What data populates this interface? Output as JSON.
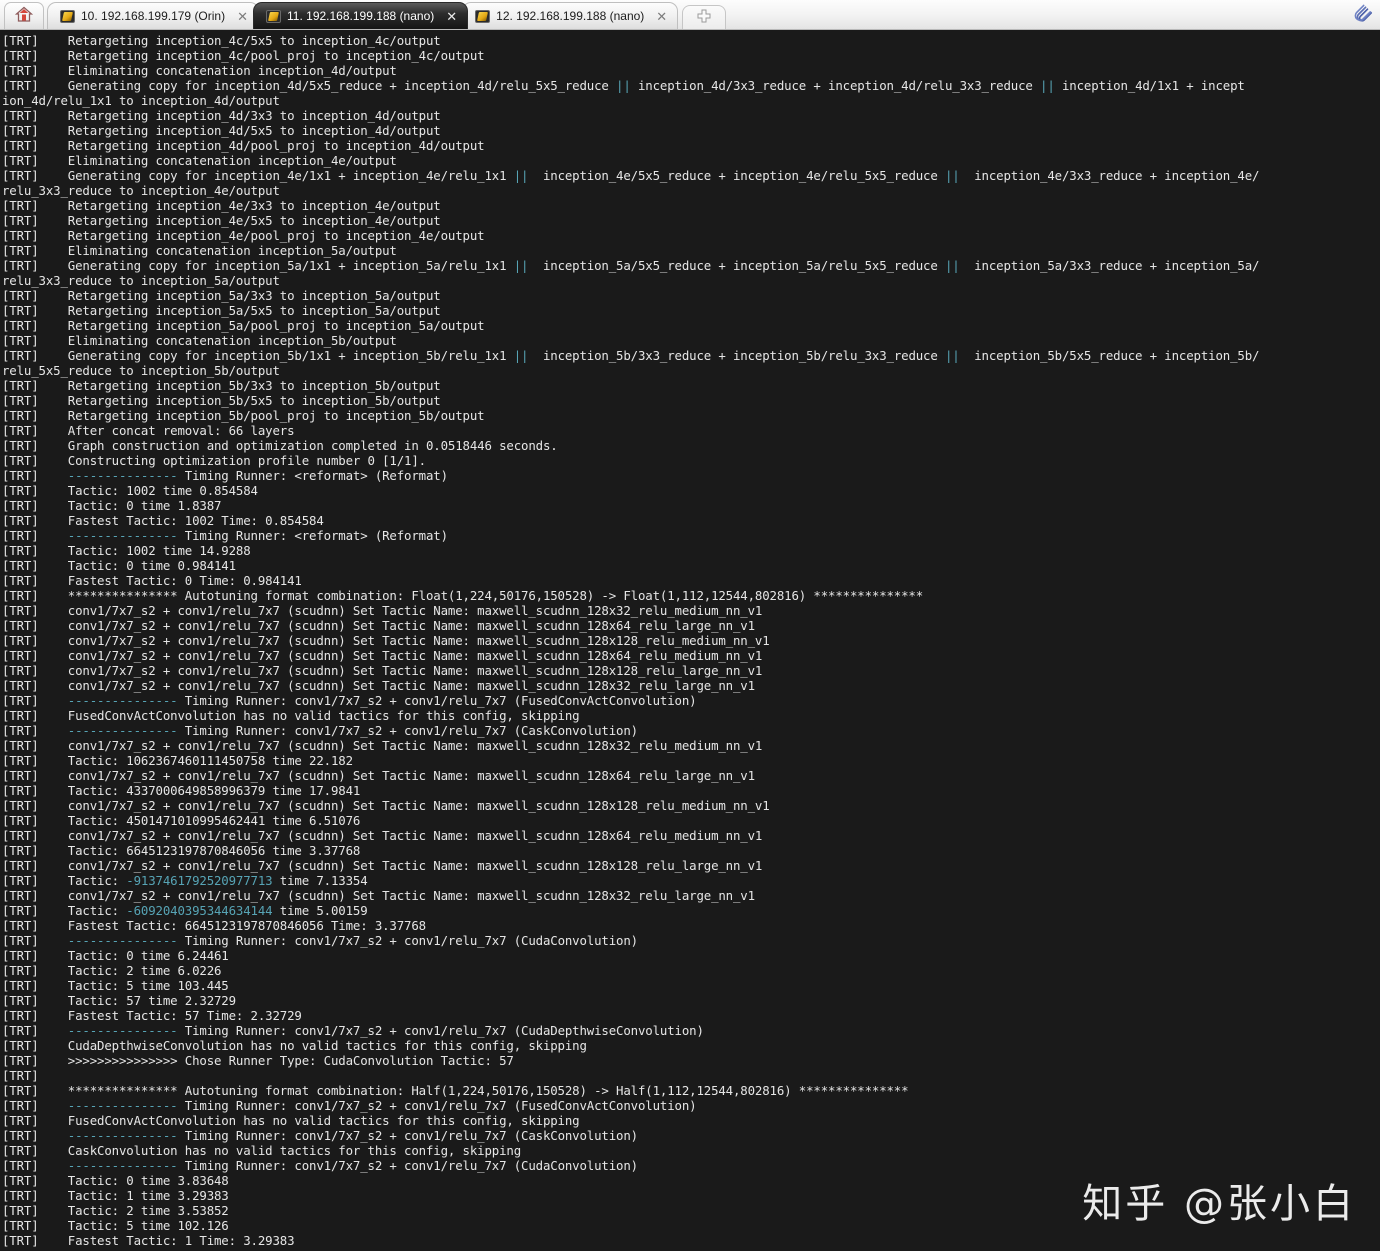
{
  "window": {
    "home_tab_icon": "home-icon",
    "attach_icon": "paperclip-icon",
    "new_tab_label": "+",
    "close_glyph": "✕"
  },
  "tabs": [
    {
      "label": "10. 192.168.199.179 (Orin)",
      "icon": "putty-terminal-icon",
      "active": false
    },
    {
      "label": "11. 192.168.199.188 (nano)",
      "icon": "putty-terminal-icon",
      "active": true
    },
    {
      "label": "12. 192.168.199.188 (nano)",
      "icon": "putty-terminal-icon",
      "active": false
    }
  ],
  "terminal": {
    "prefix": "[TRT]",
    "colors": {
      "background": "#1a1a1a",
      "foreground": "#e6e6e6",
      "accent": "#57a4b5"
    },
    "lines": [
      {
        "tag": "[TRT]",
        "segs": [
          {
            "t": "    Retargeting inception_4c/5x5 to inception_4c/output"
          }
        ]
      },
      {
        "tag": "[TRT]",
        "segs": [
          {
            "t": "    Retargeting inception_4c/pool_proj to inception_4c/output"
          }
        ]
      },
      {
        "tag": "[TRT]",
        "segs": [
          {
            "t": "    Eliminating concatenation inception_4d/output"
          }
        ]
      },
      {
        "tag": "[TRT]",
        "segs": [
          {
            "t": "    Generating copy for inception_4d/5x5_reduce + inception_4d/relu_5x5_reduce "
          },
          {
            "t": "||",
            "c": "cyan"
          },
          {
            "t": " inception_4d/3x3_reduce + inception_4d/relu_3x3_reduce "
          },
          {
            "t": "||",
            "c": "cyan"
          },
          {
            "t": " inception_4d/1x1 + incept"
          }
        ]
      },
      {
        "tag": "",
        "segs": [
          {
            "t": "ion_4d/relu_1x1 to inception_4d/output"
          }
        ]
      },
      {
        "tag": "[TRT]",
        "segs": [
          {
            "t": "    Retargeting inception_4d/3x3 to inception_4d/output"
          }
        ]
      },
      {
        "tag": "[TRT]",
        "segs": [
          {
            "t": "    Retargeting inception_4d/5x5 to inception_4d/output"
          }
        ]
      },
      {
        "tag": "[TRT]",
        "segs": [
          {
            "t": "    Retargeting inception_4d/pool_proj to inception_4d/output"
          }
        ]
      },
      {
        "tag": "[TRT]",
        "segs": [
          {
            "t": "    Eliminating concatenation inception_4e/output"
          }
        ]
      },
      {
        "tag": "[TRT]",
        "segs": [
          {
            "t": "    Generating copy for inception_4e/1x1 + inception_4e/relu_1x1 "
          },
          {
            "t": "||",
            "c": "cyan"
          },
          {
            "t": "  inception_4e/5x5_reduce + inception_4e/relu_5x5_reduce "
          },
          {
            "t": "||",
            "c": "cyan"
          },
          {
            "t": "  inception_4e/3x3_reduce + inception_4e/"
          }
        ]
      },
      {
        "tag": "",
        "segs": [
          {
            "t": "relu_3x3_reduce to inception_4e/output"
          }
        ]
      },
      {
        "tag": "[TRT]",
        "segs": [
          {
            "t": "    Retargeting inception_4e/3x3 to inception_4e/output"
          }
        ]
      },
      {
        "tag": "[TRT]",
        "segs": [
          {
            "t": "    Retargeting inception_4e/5x5 to inception_4e/output"
          }
        ]
      },
      {
        "tag": "[TRT]",
        "segs": [
          {
            "t": "    Retargeting inception_4e/pool_proj to inception_4e/output"
          }
        ]
      },
      {
        "tag": "[TRT]",
        "segs": [
          {
            "t": "    Eliminating concatenation inception_5a/output"
          }
        ]
      },
      {
        "tag": "[TRT]",
        "segs": [
          {
            "t": "    Generating copy for inception_5a/1x1 + inception_5a/relu_1x1 "
          },
          {
            "t": "||",
            "c": "cyan"
          },
          {
            "t": "  inception_5a/5x5_reduce + inception_5a/relu_5x5_reduce "
          },
          {
            "t": "||",
            "c": "cyan"
          },
          {
            "t": "  inception_5a/3x3_reduce + inception_5a/"
          }
        ]
      },
      {
        "tag": "",
        "segs": [
          {
            "t": "relu_3x3_reduce to inception_5a/output"
          }
        ]
      },
      {
        "tag": "[TRT]",
        "segs": [
          {
            "t": "    Retargeting inception_5a/3x3 to inception_5a/output"
          }
        ]
      },
      {
        "tag": "[TRT]",
        "segs": [
          {
            "t": "    Retargeting inception_5a/5x5 to inception_5a/output"
          }
        ]
      },
      {
        "tag": "[TRT]",
        "segs": [
          {
            "t": "    Retargeting inception_5a/pool_proj to inception_5a/output"
          }
        ]
      },
      {
        "tag": "[TRT]",
        "segs": [
          {
            "t": "    Eliminating concatenation inception_5b/output"
          }
        ]
      },
      {
        "tag": "[TRT]",
        "segs": [
          {
            "t": "    Generating copy for inception_5b/1x1 + inception_5b/relu_1x1 "
          },
          {
            "t": "||",
            "c": "cyan"
          },
          {
            "t": "  inception_5b/3x3_reduce + inception_5b/relu_3x3_reduce "
          },
          {
            "t": "||",
            "c": "cyan"
          },
          {
            "t": "  inception_5b/5x5_reduce + inception_5b/"
          }
        ]
      },
      {
        "tag": "",
        "segs": [
          {
            "t": "relu_5x5_reduce to inception_5b/output"
          }
        ]
      },
      {
        "tag": "[TRT]",
        "segs": [
          {
            "t": "    Retargeting inception_5b/3x3 to inception_5b/output"
          }
        ]
      },
      {
        "tag": "[TRT]",
        "segs": [
          {
            "t": "    Retargeting inception_5b/5x5 to inception_5b/output"
          }
        ]
      },
      {
        "tag": "[TRT]",
        "segs": [
          {
            "t": "    Retargeting inception_5b/pool_proj to inception_5b/output"
          }
        ]
      },
      {
        "tag": "[TRT]",
        "segs": [
          {
            "t": "    After concat removal: 66 layers"
          }
        ]
      },
      {
        "tag": "[TRT]",
        "segs": [
          {
            "t": "    Graph construction and optimization completed in 0.0518446 seconds."
          }
        ]
      },
      {
        "tag": "[TRT]",
        "segs": [
          {
            "t": "    Constructing optimization profile number 0 [1/1]."
          }
        ]
      },
      {
        "tag": "[TRT]",
        "segs": [
          {
            "t": "    ---------------",
            "c": "cyan"
          },
          {
            "t": " Timing Runner: <reformat> (Reformat)"
          }
        ]
      },
      {
        "tag": "[TRT]",
        "segs": [
          {
            "t": "    Tactic: 1002 time 0.854584"
          }
        ]
      },
      {
        "tag": "[TRT]",
        "segs": [
          {
            "t": "    Tactic: 0 time 1.8387"
          }
        ]
      },
      {
        "tag": "[TRT]",
        "segs": [
          {
            "t": "    Fastest Tactic: 1002 Time: 0.854584"
          }
        ]
      },
      {
        "tag": "[TRT]",
        "segs": [
          {
            "t": "    ---------------",
            "c": "cyan"
          },
          {
            "t": " Timing Runner: <reformat> (Reformat)"
          }
        ]
      },
      {
        "tag": "[TRT]",
        "segs": [
          {
            "t": "    Tactic: 1002 time 14.9288"
          }
        ]
      },
      {
        "tag": "[TRT]",
        "segs": [
          {
            "t": "    Tactic: 0 time 0.984141"
          }
        ]
      },
      {
        "tag": "[TRT]",
        "segs": [
          {
            "t": "    Fastest Tactic: 0 Time: 0.984141"
          }
        ]
      },
      {
        "tag": "[TRT]",
        "segs": [
          {
            "t": "    *************** Autotuning format combination: Float(1,224,50176,150528) -> Float(1,112,12544,802816) ***************"
          }
        ]
      },
      {
        "tag": "[TRT]",
        "segs": [
          {
            "t": "    conv1/7x7_s2 + conv1/relu_7x7 (scudnn) Set Tactic Name: maxwell_scudnn_128x32_relu_medium_nn_v1"
          }
        ]
      },
      {
        "tag": "[TRT]",
        "segs": [
          {
            "t": "    conv1/7x7_s2 + conv1/relu_7x7 (scudnn) Set Tactic Name: maxwell_scudnn_128x64_relu_large_nn_v1"
          }
        ]
      },
      {
        "tag": "[TRT]",
        "segs": [
          {
            "t": "    conv1/7x7_s2 + conv1/relu_7x7 (scudnn) Set Tactic Name: maxwell_scudnn_128x128_relu_medium_nn_v1"
          }
        ]
      },
      {
        "tag": "[TRT]",
        "segs": [
          {
            "t": "    conv1/7x7_s2 + conv1/relu_7x7 (scudnn) Set Tactic Name: maxwell_scudnn_128x64_relu_medium_nn_v1"
          }
        ]
      },
      {
        "tag": "[TRT]",
        "segs": [
          {
            "t": "    conv1/7x7_s2 + conv1/relu_7x7 (scudnn) Set Tactic Name: maxwell_scudnn_128x128_relu_large_nn_v1"
          }
        ]
      },
      {
        "tag": "[TRT]",
        "segs": [
          {
            "t": "    conv1/7x7_s2 + conv1/relu_7x7 (scudnn) Set Tactic Name: maxwell_scudnn_128x32_relu_large_nn_v1"
          }
        ]
      },
      {
        "tag": "[TRT]",
        "segs": [
          {
            "t": "    ---------------",
            "c": "cyan"
          },
          {
            "t": " Timing Runner: conv1/7x7_s2 + conv1/relu_7x7 (FusedConvActConvolution)"
          }
        ]
      },
      {
        "tag": "[TRT]",
        "segs": [
          {
            "t": "    FusedConvActConvolution has no valid tactics for this config, skipping"
          }
        ]
      },
      {
        "tag": "[TRT]",
        "segs": [
          {
            "t": "    ---------------",
            "c": "cyan"
          },
          {
            "t": " Timing Runner: conv1/7x7_s2 + conv1/relu_7x7 (CaskConvolution)"
          }
        ]
      },
      {
        "tag": "[TRT]",
        "segs": [
          {
            "t": "    conv1/7x7_s2 + conv1/relu_7x7 (scudnn) Set Tactic Name: maxwell_scudnn_128x32_relu_medium_nn_v1"
          }
        ]
      },
      {
        "tag": "[TRT]",
        "segs": [
          {
            "t": "    Tactic: 1062367460111450758 time 22.182"
          }
        ]
      },
      {
        "tag": "[TRT]",
        "segs": [
          {
            "t": "    conv1/7x7_s2 + conv1/relu_7x7 (scudnn) Set Tactic Name: maxwell_scudnn_128x64_relu_large_nn_v1"
          }
        ]
      },
      {
        "tag": "[TRT]",
        "segs": [
          {
            "t": "    Tactic: 4337000649858996379 time 17.9841"
          }
        ]
      },
      {
        "tag": "[TRT]",
        "segs": [
          {
            "t": "    conv1/7x7_s2 + conv1/relu_7x7 (scudnn) Set Tactic Name: maxwell_scudnn_128x128_relu_medium_nn_v1"
          }
        ]
      },
      {
        "tag": "[TRT]",
        "segs": [
          {
            "t": "    Tactic: 4501471010995462441 time 6.51076"
          }
        ]
      },
      {
        "tag": "[TRT]",
        "segs": [
          {
            "t": "    conv1/7x7_s2 + conv1/relu_7x7 (scudnn) Set Tactic Name: maxwell_scudnn_128x64_relu_medium_nn_v1"
          }
        ]
      },
      {
        "tag": "[TRT]",
        "segs": [
          {
            "t": "    Tactic: 6645123197870846056 time 3.37768"
          }
        ]
      },
      {
        "tag": "[TRT]",
        "segs": [
          {
            "t": "    conv1/7x7_s2 + conv1/relu_7x7 (scudnn) Set Tactic Name: maxwell_scudnn_128x128_relu_large_nn_v1"
          }
        ]
      },
      {
        "tag": "[TRT]",
        "segs": [
          {
            "t": "    Tactic: "
          },
          {
            "t": "-9137461792520977713",
            "c": "cyan"
          },
          {
            "t": " time 7.13354"
          }
        ]
      },
      {
        "tag": "[TRT]",
        "segs": [
          {
            "t": "    conv1/7x7_s2 + conv1/relu_7x7 (scudnn) Set Tactic Name: maxwell_scudnn_128x32_relu_large_nn_v1"
          }
        ]
      },
      {
        "tag": "[TRT]",
        "segs": [
          {
            "t": "    Tactic: "
          },
          {
            "t": "-6092040395344634144",
            "c": "cyan"
          },
          {
            "t": " time 5.00159"
          }
        ]
      },
      {
        "tag": "[TRT]",
        "segs": [
          {
            "t": "    Fastest Tactic: 6645123197870846056 Time: 3.37768"
          }
        ]
      },
      {
        "tag": "[TRT]",
        "segs": [
          {
            "t": "    ---------------",
            "c": "cyan"
          },
          {
            "t": " Timing Runner: conv1/7x7_s2 + conv1/relu_7x7 (CudaConvolution)"
          }
        ]
      },
      {
        "tag": "[TRT]",
        "segs": [
          {
            "t": "    Tactic: 0 time 6.24461"
          }
        ]
      },
      {
        "tag": "[TRT]",
        "segs": [
          {
            "t": "    Tactic: 2 time 6.0226"
          }
        ]
      },
      {
        "tag": "[TRT]",
        "segs": [
          {
            "t": "    Tactic: 5 time 103.445"
          }
        ]
      },
      {
        "tag": "[TRT]",
        "segs": [
          {
            "t": "    Tactic: 57 time 2.32729"
          }
        ]
      },
      {
        "tag": "[TRT]",
        "segs": [
          {
            "t": "    Fastest Tactic: 57 Time: 2.32729"
          }
        ]
      },
      {
        "tag": "[TRT]",
        "segs": [
          {
            "t": "    ---------------",
            "c": "cyan"
          },
          {
            "t": " Timing Runner: conv1/7x7_s2 + conv1/relu_7x7 (CudaDepthwiseConvolution)"
          }
        ]
      },
      {
        "tag": "[TRT]",
        "segs": [
          {
            "t": "    CudaDepthwiseConvolution has no valid tactics for this config, skipping"
          }
        ]
      },
      {
        "tag": "[TRT]",
        "segs": [
          {
            "t": "    >>>>>>>>>>>>>>> Chose Runner Type: CudaConvolution Tactic: 57"
          }
        ]
      },
      {
        "tag": "[TRT]",
        "segs": [
          {
            "t": ""
          }
        ]
      },
      {
        "tag": "[TRT]",
        "segs": [
          {
            "t": "    *************** Autotuning format combination: Half(1,224,50176,150528) -> Half(1,112,12544,802816) ***************"
          }
        ]
      },
      {
        "tag": "[TRT]",
        "segs": [
          {
            "t": "    ---------------",
            "c": "cyan"
          },
          {
            "t": " Timing Runner: conv1/7x7_s2 + conv1/relu_7x7 (FusedConvActConvolution)"
          }
        ]
      },
      {
        "tag": "[TRT]",
        "segs": [
          {
            "t": "    FusedConvActConvolution has no valid tactics for this config, skipping"
          }
        ]
      },
      {
        "tag": "[TRT]",
        "segs": [
          {
            "t": "    ---------------",
            "c": "cyan"
          },
          {
            "t": " Timing Runner: conv1/7x7_s2 + conv1/relu_7x7 (CaskConvolution)"
          }
        ]
      },
      {
        "tag": "[TRT]",
        "segs": [
          {
            "t": "    CaskConvolution has no valid tactics for this config, skipping"
          }
        ]
      },
      {
        "tag": "[TRT]",
        "segs": [
          {
            "t": "    ---------------",
            "c": "cyan"
          },
          {
            "t": " Timing Runner: conv1/7x7_s2 + conv1/relu_7x7 (CudaConvolution)"
          }
        ]
      },
      {
        "tag": "[TRT]",
        "segs": [
          {
            "t": "    Tactic: 0 time 3.83648"
          }
        ]
      },
      {
        "tag": "[TRT]",
        "segs": [
          {
            "t": "    Tactic: 1 time 3.29383"
          }
        ]
      },
      {
        "tag": "[TRT]",
        "segs": [
          {
            "t": "    Tactic: 2 time 3.53852"
          }
        ]
      },
      {
        "tag": "[TRT]",
        "segs": [
          {
            "t": "    Tactic: 5 time 102.126"
          }
        ]
      },
      {
        "tag": "[TRT]",
        "segs": [
          {
            "t": "    Fastest Tactic: 1 Time: 3.29383"
          }
        ]
      }
    ]
  },
  "watermark": {
    "text": "知乎 @张小白"
  }
}
